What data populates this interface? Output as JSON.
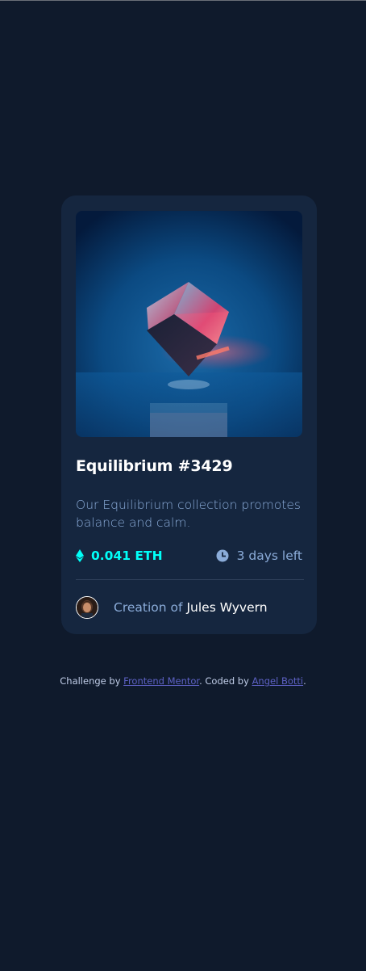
{
  "card": {
    "title": "Equilibrium #3429",
    "description": "Our Equilibrium collection promotes balance and calm.",
    "price": "0.041 ETH",
    "time_left": "3 days left",
    "creator_prefix": "Creation of",
    "creator_name": "Jules Wyvern",
    "icons": {
      "price": "ethereum-icon",
      "time": "clock-icon"
    }
  },
  "footer": {
    "text1": "Challenge by ",
    "link1": "Frontend Mentor",
    "text2": ". Coded by ",
    "link2": "Angel Botti",
    "text3": "."
  },
  "colors": {
    "background": "#0f1a2c",
    "card": "#15263f",
    "accent_cyan": "#00fff8",
    "soft_blue": "#8bacd9",
    "link": "#5d61c4"
  }
}
